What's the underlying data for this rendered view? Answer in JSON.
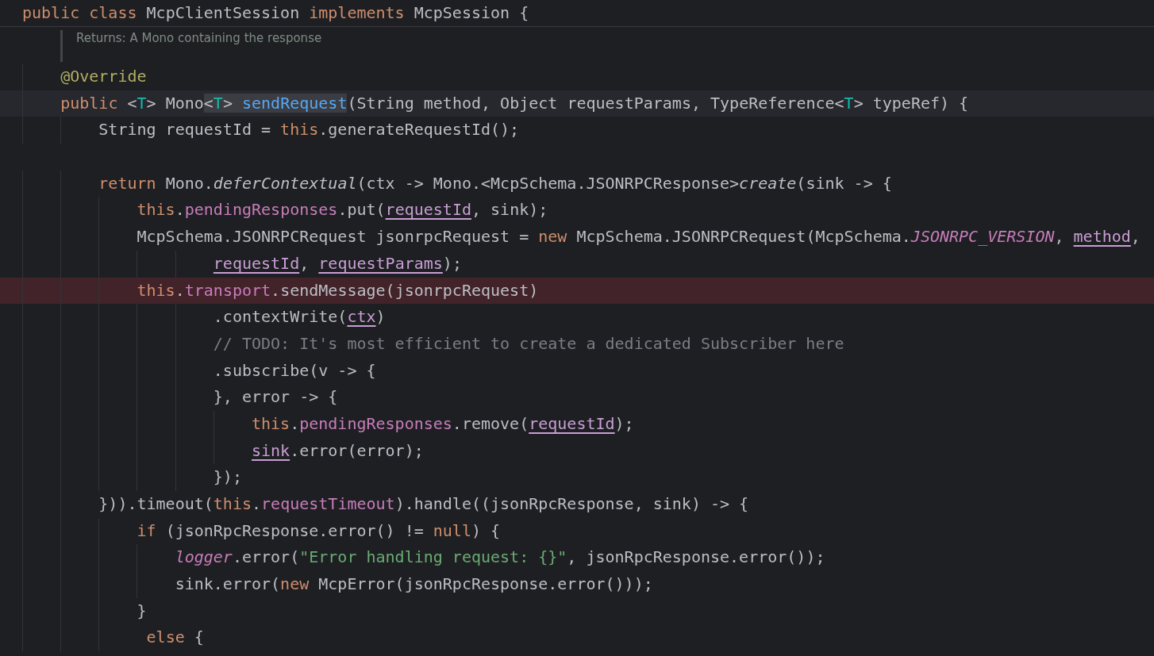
{
  "lines": [
    {
      "kind": "sticky",
      "tokens": [
        {
          "kind": "kw",
          "text": "public class "
        },
        {
          "kind": "p",
          "text": "McpClientSession "
        },
        {
          "kind": "kw",
          "text": "implements "
        },
        {
          "kind": "p",
          "text": "McpSession {"
        }
      ]
    },
    {
      "kind": "doc",
      "text": "Returns: A Mono containing the response"
    },
    {
      "kind": "code",
      "breakpoint": false,
      "caret_line": false,
      "tokens": [
        {
          "kind": "anno",
          "text": "    @Override"
        }
      ]
    },
    {
      "kind": "code",
      "breakpoint": false,
      "caret_line": true,
      "tokens": [
        {
          "kind": "kw",
          "text": "    public "
        },
        {
          "kind": "p",
          "text": "<"
        },
        {
          "kind": "tp",
          "text": "T"
        },
        {
          "kind": "p",
          "text": "> Mono"
        },
        {
          "kind": "pm",
          "text": "<"
        },
        {
          "kind": "tpm",
          "text": "T"
        },
        {
          "kind": "pm",
          "text": "> "
        },
        {
          "kind": "declm",
          "text": "sendRequest"
        },
        {
          "kind": "p",
          "text": "(String method, Object requestParams, TypeReference<"
        },
        {
          "kind": "tp",
          "text": "T"
        },
        {
          "kind": "p",
          "text": "> typeRef) {"
        }
      ]
    },
    {
      "kind": "code",
      "breakpoint": false,
      "caret_line": false,
      "tokens": [
        {
          "kind": "p",
          "text": "        String requestId = "
        },
        {
          "kind": "kw",
          "text": "this"
        },
        {
          "kind": "p",
          "text": ".generateRequestId();"
        }
      ]
    },
    {
      "kind": "blank"
    },
    {
      "kind": "code",
      "breakpoint": false,
      "caret_line": false,
      "tokens": [
        {
          "kind": "kw",
          "text": "        return "
        },
        {
          "kind": "p",
          "text": "Mono."
        },
        {
          "kind": "sm",
          "text": "deferContextual"
        },
        {
          "kind": "p",
          "text": "(ctx -> Mono.<McpSchema.JSONRPCResponse>"
        },
        {
          "kind": "sm",
          "text": "create"
        },
        {
          "kind": "p",
          "text": "(sink -> {"
        }
      ]
    },
    {
      "kind": "code",
      "breakpoint": false,
      "caret_line": false,
      "tokens": [
        {
          "kind": "kw",
          "text": "            this"
        },
        {
          "kind": "p",
          "text": "."
        },
        {
          "kind": "fld",
          "text": "pendingResponses"
        },
        {
          "kind": "p",
          "text": ".put("
        },
        {
          "kind": "cap",
          "text": "requestId"
        },
        {
          "kind": "p",
          "text": ", sink);"
        }
      ]
    },
    {
      "kind": "code",
      "breakpoint": false,
      "caret_line": false,
      "tokens": [
        {
          "kind": "p",
          "text": "            McpSchema.JSONRPCRequest jsonrpcRequest = "
        },
        {
          "kind": "kw",
          "text": "new "
        },
        {
          "kind": "p",
          "text": "McpSchema.JSONRPCRequest(McpSchema."
        },
        {
          "kind": "sfld",
          "text": "JSONRPC_VERSION"
        },
        {
          "kind": "p",
          "text": ", "
        },
        {
          "kind": "cap",
          "text": "method"
        },
        {
          "kind": "p",
          "text": ","
        }
      ]
    },
    {
      "kind": "code",
      "breakpoint": false,
      "caret_line": false,
      "tokens": [
        {
          "kind": "cap",
          "text": "                    requestId"
        },
        {
          "kind": "p",
          "text": ", "
        },
        {
          "kind": "cap",
          "text": "requestParams"
        },
        {
          "kind": "p",
          "text": ");"
        }
      ]
    },
    {
      "kind": "code",
      "breakpoint": true,
      "caret_line": false,
      "tokens": [
        {
          "kind": "kw",
          "text": "            this"
        },
        {
          "kind": "p",
          "text": "."
        },
        {
          "kind": "fld",
          "text": "transport"
        },
        {
          "kind": "p",
          "text": ".sendMessage(jsonrpcRequest)"
        }
      ]
    },
    {
      "kind": "code",
      "breakpoint": false,
      "caret_line": false,
      "tokens": [
        {
          "kind": "p",
          "text": "                    .contextWrite("
        },
        {
          "kind": "cap",
          "text": "ctx"
        },
        {
          "kind": "p",
          "text": ")"
        }
      ]
    },
    {
      "kind": "code",
      "breakpoint": false,
      "caret_line": false,
      "tokens": [
        {
          "kind": "cmt",
          "text": "                    // TODO: It's most efficient to create a dedicated Subscriber here"
        }
      ]
    },
    {
      "kind": "code",
      "breakpoint": false,
      "caret_line": false,
      "tokens": [
        {
          "kind": "p",
          "text": "                    .subscribe(v -> {"
        }
      ]
    },
    {
      "kind": "code",
      "breakpoint": false,
      "caret_line": false,
      "tokens": [
        {
          "kind": "p",
          "text": "                    }, error -> {"
        }
      ]
    },
    {
      "kind": "code",
      "breakpoint": false,
      "caret_line": false,
      "tokens": [
        {
          "kind": "kw",
          "text": "                        this"
        },
        {
          "kind": "p",
          "text": "."
        },
        {
          "kind": "fld",
          "text": "pendingResponses"
        },
        {
          "kind": "p",
          "text": ".remove("
        },
        {
          "kind": "cap",
          "text": "requestId"
        },
        {
          "kind": "p",
          "text": ");"
        }
      ]
    },
    {
      "kind": "code",
      "breakpoint": false,
      "caret_line": false,
      "tokens": [
        {
          "kind": "cap",
          "text": "                        sink"
        },
        {
          "kind": "p",
          "text": ".error(error);"
        }
      ]
    },
    {
      "kind": "code",
      "breakpoint": false,
      "caret_line": false,
      "tokens": [
        {
          "kind": "p",
          "text": "                    });"
        }
      ]
    },
    {
      "kind": "code",
      "breakpoint": false,
      "caret_line": false,
      "tokens": [
        {
          "kind": "p",
          "text": "        })).timeout("
        },
        {
          "kind": "kw",
          "text": "this"
        },
        {
          "kind": "p",
          "text": "."
        },
        {
          "kind": "fld",
          "text": "requestTimeout"
        },
        {
          "kind": "p",
          "text": ").handle((jsonRpcResponse, sink) -> {"
        }
      ]
    },
    {
      "kind": "code",
      "breakpoint": false,
      "caret_line": false,
      "tokens": [
        {
          "kind": "kw",
          "text": "            if "
        },
        {
          "kind": "p",
          "text": "(jsonRpcResponse.error() != "
        },
        {
          "kind": "kw",
          "text": "null"
        },
        {
          "kind": "p",
          "text": ") {"
        }
      ]
    },
    {
      "kind": "code",
      "breakpoint": false,
      "caret_line": false,
      "tokens": [
        {
          "kind": "sfld",
          "text": "                logger"
        },
        {
          "kind": "p",
          "text": ".error("
        },
        {
          "kind": "str",
          "text": "\"Error handling request: {}\""
        },
        {
          "kind": "p",
          "text": ", jsonRpcResponse.error());"
        }
      ]
    },
    {
      "kind": "code",
      "breakpoint": false,
      "caret_line": false,
      "tokens": [
        {
          "kind": "p",
          "text": "                sink.error("
        },
        {
          "kind": "kw",
          "text": "new "
        },
        {
          "kind": "p",
          "text": "McpError(jsonRpcResponse.error()));"
        }
      ]
    },
    {
      "kind": "code",
      "breakpoint": false,
      "caret_line": false,
      "tokens": [
        {
          "kind": "p",
          "text": "            }"
        }
      ]
    },
    {
      "kind": "code",
      "breakpoint": false,
      "caret_line": false,
      "tokens": [
        {
          "kind": "kw",
          "text": "             else "
        },
        {
          "kind": "p",
          "text": "{"
        }
      ]
    }
  ]
}
